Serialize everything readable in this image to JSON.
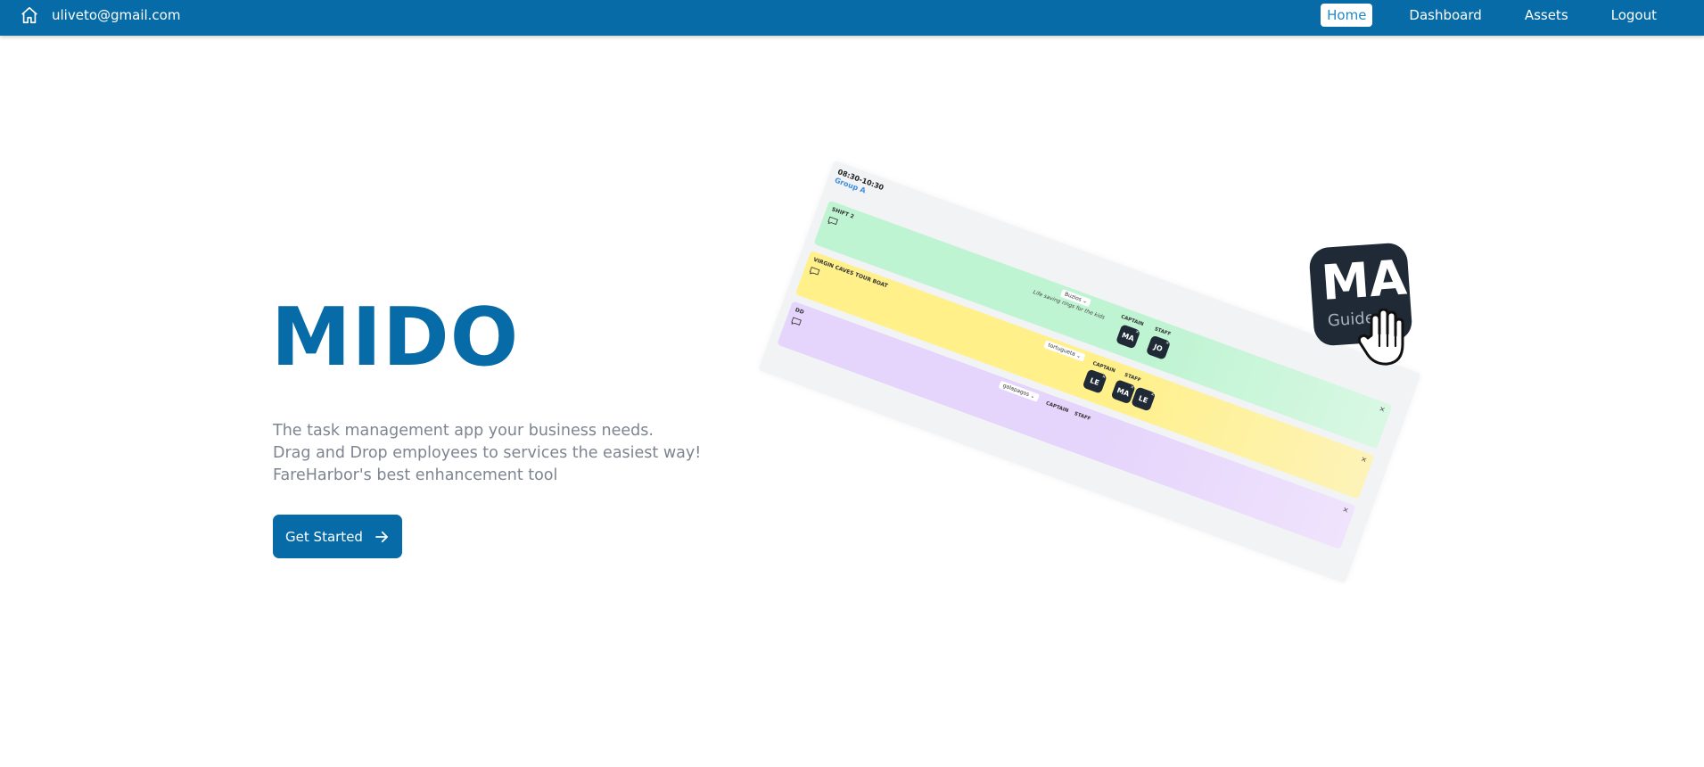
{
  "nav": {
    "email": "uliveto@gmail.com",
    "links": [
      {
        "label": "Home",
        "active": true
      },
      {
        "label": "Dashboard",
        "active": false
      },
      {
        "label": "Assets",
        "active": false
      },
      {
        "label": "Logout",
        "active": false
      }
    ],
    "colors": {
      "bar": "#066ba6",
      "active_text": "#1e88c8"
    }
  },
  "hero": {
    "title": "MIDO",
    "lines": [
      "The task management app your business needs.",
      "Drag and Drop employees to services the easiest way!",
      "FareHarbor's best enhancement tool"
    ],
    "cta_label": "Get Started",
    "cta_icon": "arrow-right-icon"
  },
  "board": {
    "time": "08:30-10:30",
    "group": "Group A",
    "shifts": [
      {
        "name": "SHIFT 2",
        "color": "#bff4d2",
        "select": "Buzios",
        "note": "Life saving rings for the kids",
        "captain_label": "CAPTAIN",
        "staff_label": "STAFF",
        "captain": [
          "MA"
        ],
        "staff": [
          "JO"
        ]
      },
      {
        "name": "VIRGIN CAVES TOUR BOAT",
        "color": "#fff08a",
        "select": "tortugueta",
        "note": "",
        "captain_label": "CAPTAIN",
        "staff_label": "STAFF",
        "captain": [
          "LE"
        ],
        "staff": [
          "MA",
          "LE"
        ]
      },
      {
        "name": "DD",
        "color": "#e5d4fb",
        "select": "galapagos",
        "note": "",
        "captain_label": "CAPTAIN",
        "staff_label": "STAFF",
        "captain": [],
        "staff": []
      }
    ],
    "dragging": {
      "initials": "MA",
      "role": "Guide"
    }
  }
}
